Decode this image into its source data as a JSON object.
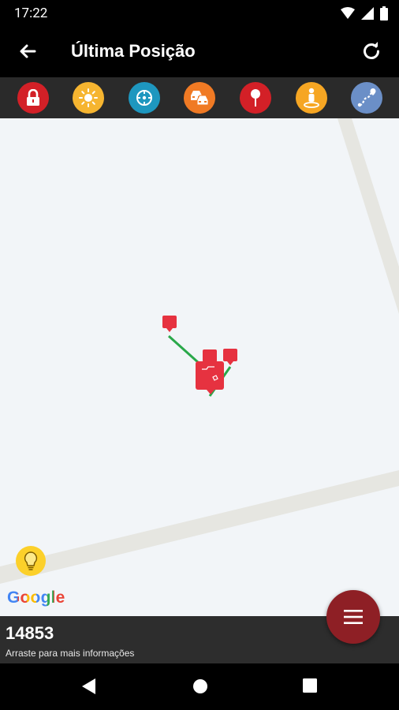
{
  "status_bar": {
    "time": "17:22",
    "icons": [
      "wifi-icon",
      "signal-icon",
      "battery-icon"
    ]
  },
  "app_bar": {
    "title": "Última Posição",
    "back_icon": "arrow-left-icon",
    "refresh_icon": "refresh-icon"
  },
  "toolbar": {
    "buttons": [
      {
        "name": "lock",
        "color": "#d32027"
      },
      {
        "name": "sun",
        "color": "#f6b530"
      },
      {
        "name": "compass",
        "color": "#1e97bf"
      },
      {
        "name": "traffic",
        "color": "#f07a24"
      },
      {
        "name": "pin",
        "color": "#d32027"
      },
      {
        "name": "street-view",
        "color": "#f6a623"
      },
      {
        "name": "route",
        "color": "#6b8fc7"
      }
    ]
  },
  "map": {
    "attribution": "Google",
    "route_color": "#2aa84a",
    "marker_color": "#e63240",
    "light_button": "bulb-icon"
  },
  "bottom_panel": {
    "vehicle_id": "14853",
    "hint": "Arraste para mais informações"
  },
  "fab": {
    "icon": "menu-icon",
    "color": "#8e1f25"
  },
  "nav_bar": {
    "icons": [
      "back-triangle-icon",
      "home-circle-icon",
      "recents-square-icon"
    ]
  }
}
